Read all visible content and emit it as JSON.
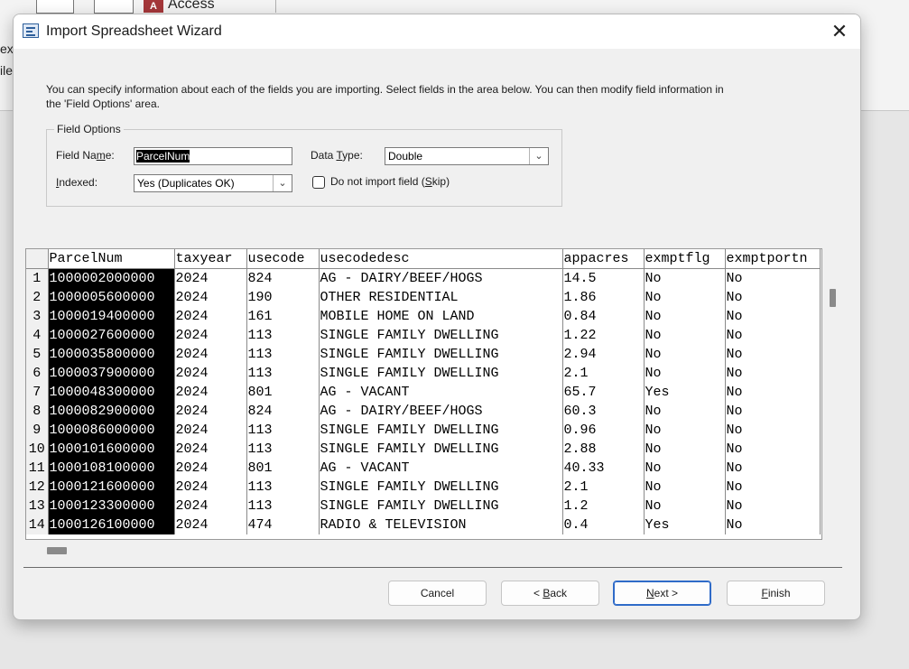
{
  "background": {
    "access_logo": "A",
    "app_label": "Access",
    "side_text_1": "ext",
    "side_text_2": "ile"
  },
  "dialog": {
    "title": "Import Spreadsheet Wizard",
    "close_glyph": "✕",
    "icon": "wizard-icon",
    "instructions": "You can specify information about each of the fields you are importing. Select fields in the area below. You can then modify field information in the 'Field Options' area."
  },
  "field_options": {
    "legend": "Field Options",
    "field_name_label": {
      "pre": "Field Na",
      "key": "m",
      "post": "e:"
    },
    "field_name_value": "ParcelNum",
    "data_type_label": {
      "pre": "Data ",
      "key": "T",
      "post": "ype:"
    },
    "data_type_value": "Double",
    "indexed_label": {
      "pre": "",
      "key": "I",
      "post": "ndexed:"
    },
    "indexed_value": "Yes (Duplicates OK)",
    "skip_label": {
      "pre": "Do not import field (",
      "key": "S",
      "post": "kip)"
    },
    "skip_checked": false
  },
  "grid": {
    "columns": [
      "ParcelNum",
      "taxyear",
      "usecode",
      "usecodedesc",
      "appacres",
      "exmptflg",
      "exmptportn"
    ],
    "rows": [
      [
        "1",
        "1000002000000",
        "2024",
        "824",
        "AG - DAIRY/BEEF/HOGS",
        "14.5",
        "No",
        "No"
      ],
      [
        "2",
        "1000005600000",
        "2024",
        "190",
        "OTHER RESIDENTIAL",
        "1.86",
        "No",
        "No"
      ],
      [
        "3",
        "1000019400000",
        "2024",
        "161",
        "MOBILE HOME ON LAND",
        "0.84",
        "No",
        "No"
      ],
      [
        "4",
        "1000027600000",
        "2024",
        "113",
        "SINGLE FAMILY DWELLING",
        "1.22",
        "No",
        "No"
      ],
      [
        "5",
        "1000035800000",
        "2024",
        "113",
        "SINGLE FAMILY DWELLING",
        "2.94",
        "No",
        "No"
      ],
      [
        "6",
        "1000037900000",
        "2024",
        "113",
        "SINGLE FAMILY DWELLING",
        "2.1",
        "No",
        "No"
      ],
      [
        "7",
        "1000048300000",
        "2024",
        "801",
        "AG - VACANT",
        "65.7",
        "Yes",
        "No"
      ],
      [
        "8",
        "1000082900000",
        "2024",
        "824",
        "AG - DAIRY/BEEF/HOGS",
        "60.3",
        "No",
        "No"
      ],
      [
        "9",
        "1000086000000",
        "2024",
        "113",
        "SINGLE FAMILY DWELLING",
        "0.96",
        "No",
        "No"
      ],
      [
        "10",
        "1000101600000",
        "2024",
        "113",
        "SINGLE FAMILY DWELLING",
        "2.88",
        "No",
        "No"
      ],
      [
        "11",
        "1000108100000",
        "2024",
        "801",
        "AG - VACANT",
        "40.33",
        "No",
        "No"
      ],
      [
        "12",
        "1000121600000",
        "2024",
        "113",
        "SINGLE FAMILY DWELLING",
        "2.1",
        "No",
        "No"
      ],
      [
        "13",
        "1000123300000",
        "2024",
        "113",
        "SINGLE FAMILY DWELLING",
        "1.2",
        "No",
        "No"
      ],
      [
        "14",
        "1000126100000",
        "2024",
        "474",
        "RADIO & TELEVISION",
        "0.4",
        "Yes",
        "No"
      ]
    ]
  },
  "buttons": {
    "cancel": {
      "pre": "Cancel",
      "key": "",
      "post": ""
    },
    "back": {
      "pre": "< ",
      "key": "B",
      "post": "ack"
    },
    "next": {
      "pre": "",
      "key": "N",
      "post": "ext >"
    },
    "finish": {
      "pre": "",
      "key": "F",
      "post": "inish"
    }
  }
}
